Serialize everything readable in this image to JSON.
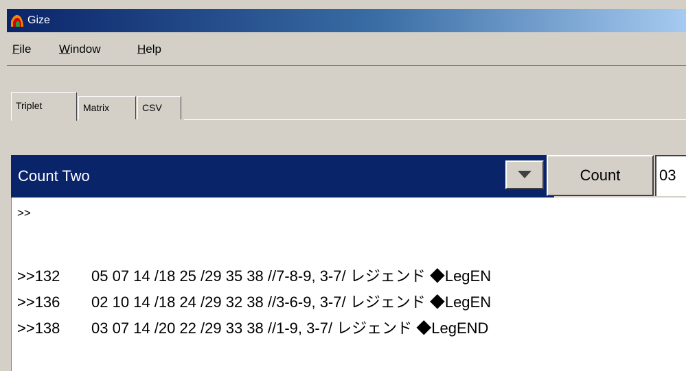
{
  "window": {
    "title": "Gize"
  },
  "menu": {
    "file": "File",
    "window": "Window",
    "help": "Help"
  },
  "tabs": [
    "Triplet",
    "Matrix",
    "CSV"
  ],
  "toolbar": {
    "combo_value": "Count Two",
    "count_label": "Count",
    "count_field_value": "03"
  },
  "output": {
    "prompt": ">>",
    "rows": [
      {
        "id": ">>132",
        "text": "05 07 14 /18 25 /29 35 38 //7-8-9, 3-7/    レジェンド ◆LegEN"
      },
      {
        "id": ">>136",
        "text": "02 10 14 /18 24 /29 32 38 //3-6-9, 3-7/    レジェンド ◆LegEN"
      },
      {
        "id": ">>138",
        "text": "03 07 14 /20 22 /29 33 38 //1-9, 3-7/    レジェンド ◆LegEND"
      }
    ]
  },
  "icons": {
    "app": "gize-app-icon",
    "dropdown": "chevron-down-icon"
  },
  "colors": {
    "selection": "#0a246a",
    "face": "#d4d0c8"
  }
}
